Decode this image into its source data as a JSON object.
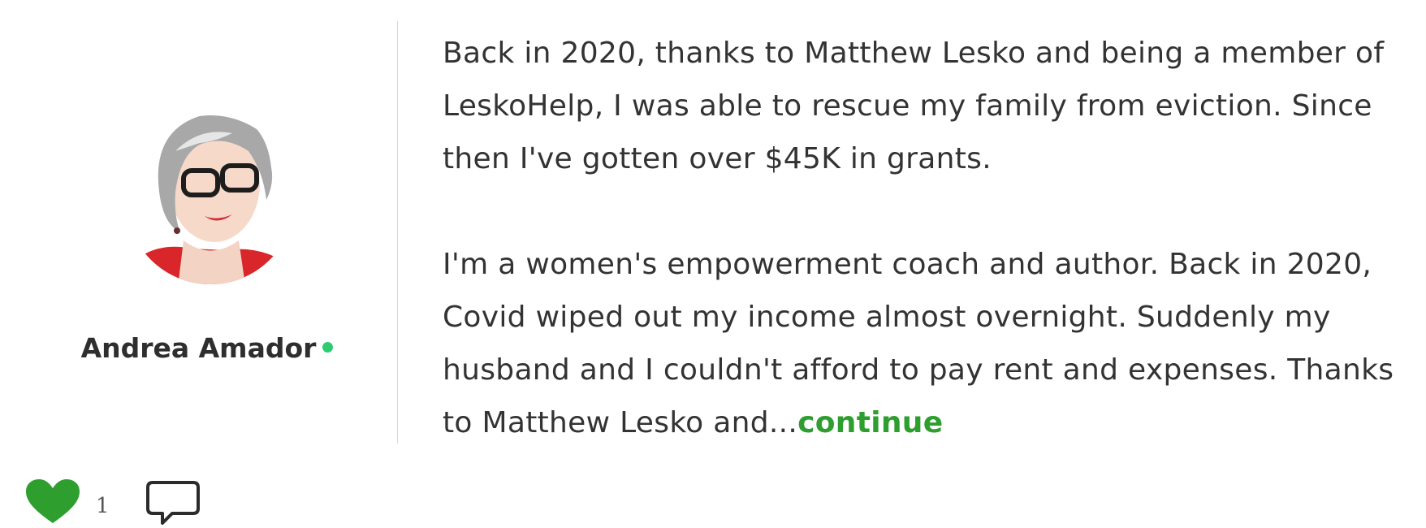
{
  "author": {
    "name": "Andrea Amador",
    "online": true
  },
  "post": {
    "paragraph_1": "Back in 2020, thanks to Matthew Lesko and being a member of LeskoHelp, I was able to rescue my family from eviction. Since then I've gotten over $45K in grants.",
    "paragraph_2_prefix": "I'm a women's empowerment coach and author. Back in 2020, Covid wiped out my income almost overnight. Suddenly my husband and I couldn't afford to pay rent and expenses. Thanks to Matthew Lesko and...",
    "continue_label": "continue"
  },
  "actions": {
    "like_count": "1",
    "like_icon": "heart-icon",
    "comment_icon": "comment-icon"
  },
  "colors": {
    "accent_green": "#2e9f2e",
    "online_dot": "#2ecc71",
    "heart_green": "#2e9f2e"
  }
}
